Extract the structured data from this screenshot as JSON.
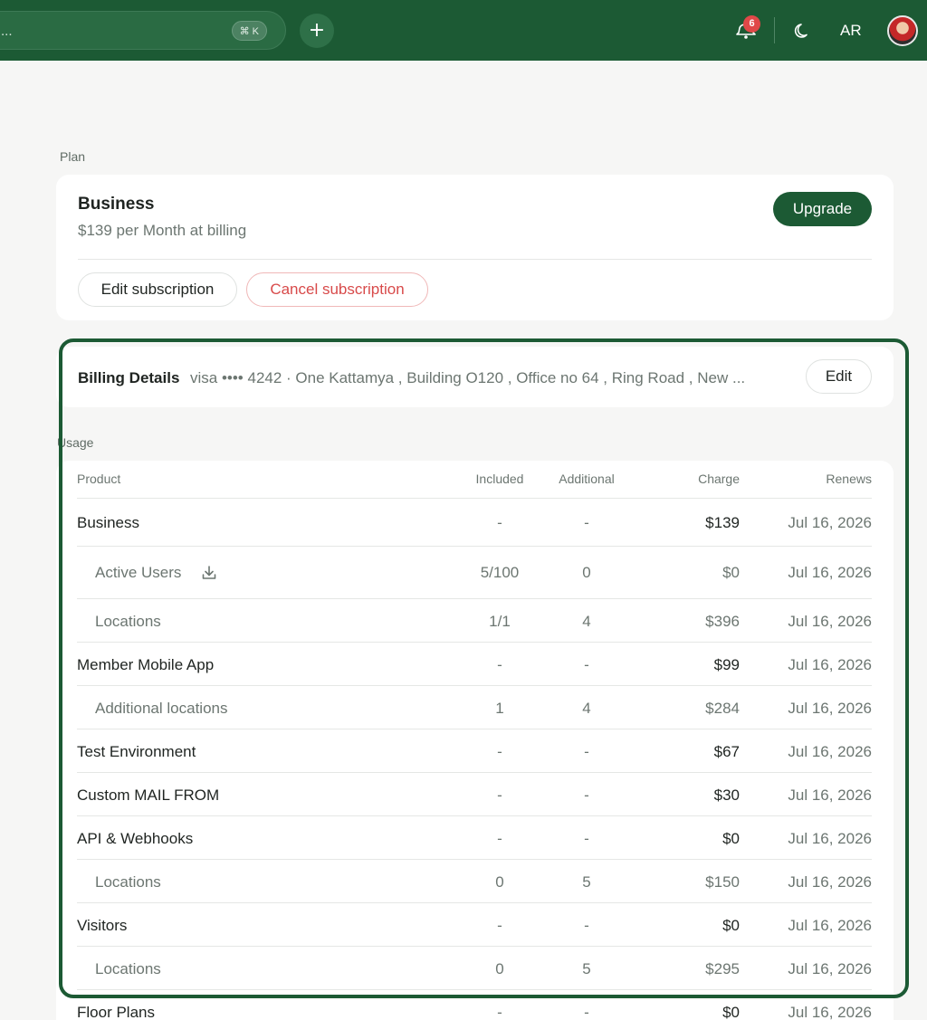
{
  "topbar": {
    "search_placeholder": "...",
    "search_shortcut": "⌘ K",
    "add_label": "+",
    "notifications_count": "6",
    "language": "AR"
  },
  "plan": {
    "section_label": "Plan",
    "name": "Business",
    "price_text": "$139 per Month at billing",
    "upgrade_label": "Upgrade",
    "edit_subscription_label": "Edit subscription",
    "cancel_subscription_label": "Cancel subscription"
  },
  "billing": {
    "title": "Billing Details",
    "detail": "visa •••• 4242 · One Kattamya , Building O120 , Office no 64 , Ring Road , New ...",
    "edit_label": "Edit"
  },
  "usage": {
    "section_label": "Usage",
    "columns": {
      "product": "Product",
      "included": "Included",
      "additional": "Additional",
      "charge": "Charge",
      "renews": "Renews"
    },
    "rows": [
      {
        "product": "Business",
        "included": "-",
        "additional": "-",
        "charge": "$139",
        "renews": "Jul 16, 2026",
        "level": "main"
      },
      {
        "product": "Active Users",
        "included": "5/100",
        "additional": "0",
        "charge": "$0",
        "renews": "Jul 16, 2026",
        "level": "sub",
        "icon": "download-icon"
      },
      {
        "product": "Locations",
        "included": "1/1",
        "additional": "4",
        "charge": "$396",
        "renews": "Jul 16, 2026",
        "level": "sub"
      },
      {
        "product": "Member Mobile App",
        "included": "-",
        "additional": "-",
        "charge": "$99",
        "renews": "Jul 16, 2026",
        "level": "main"
      },
      {
        "product": "Additional locations",
        "included": "1",
        "additional": "4",
        "charge": "$284",
        "renews": "Jul 16, 2026",
        "level": "sub"
      },
      {
        "product": "Test Environment",
        "included": "-",
        "additional": "-",
        "charge": "$67",
        "renews": "Jul 16, 2026",
        "level": "main"
      },
      {
        "product": "Custom MAIL FROM",
        "included": "-",
        "additional": "-",
        "charge": "$30",
        "renews": "Jul 16, 2026",
        "level": "main"
      },
      {
        "product": "API & Webhooks",
        "included": "-",
        "additional": "-",
        "charge": "$0",
        "renews": "Jul 16, 2026",
        "level": "main"
      },
      {
        "product": "Locations",
        "included": "0",
        "additional": "5",
        "charge": "$150",
        "renews": "Jul 16, 2026",
        "level": "sub"
      },
      {
        "product": "Visitors",
        "included": "-",
        "additional": "-",
        "charge": "$0",
        "renews": "Jul 16, 2026",
        "level": "main"
      },
      {
        "product": "Locations",
        "included": "0",
        "additional": "5",
        "charge": "$295",
        "renews": "Jul 16, 2026",
        "level": "sub"
      },
      {
        "product": "Floor Plans",
        "included": "-",
        "additional": "-",
        "charge": "$0",
        "renews": "Jul 16, 2026",
        "level": "main"
      }
    ]
  },
  "colors": {
    "brand": "#1c5a34",
    "danger": "#d84a4a",
    "badge": "#e04848"
  }
}
